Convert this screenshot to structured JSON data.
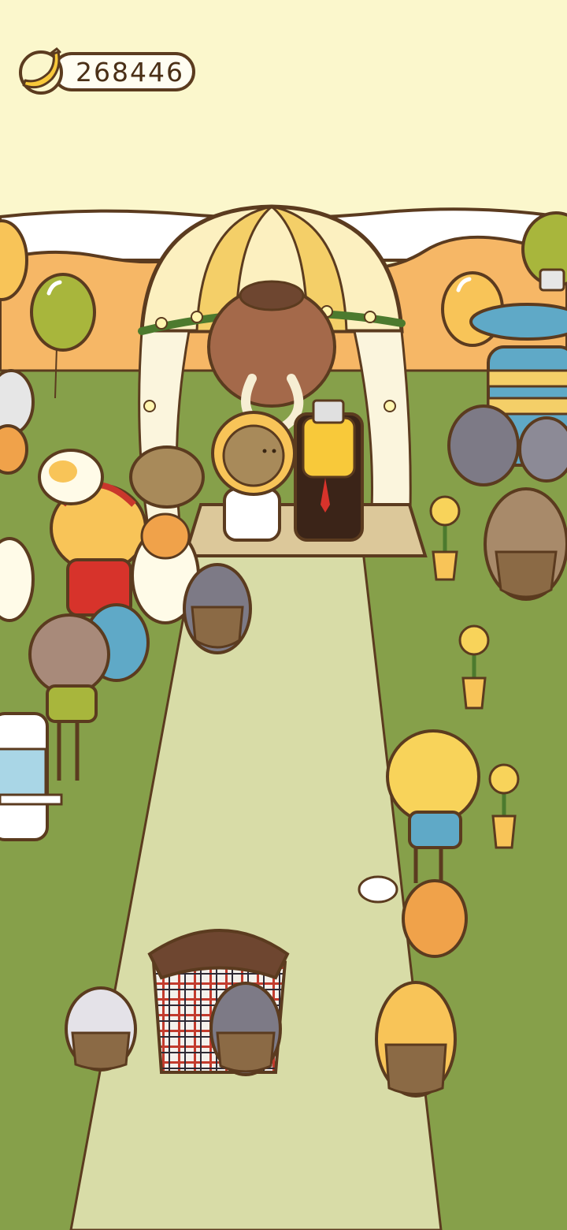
{
  "hud": {
    "banana_count": "268446",
    "currency_icon": "banana-icon"
  },
  "scene": {
    "name": "wedding-ceremony",
    "colors": {
      "sky": "#fbf7cc",
      "grass": "#86a04a",
      "aisle": "#d8dca7",
      "outline": "#5b3b1f",
      "arch_yellow": "#f4cf68",
      "arch_cream": "#fcf0c0"
    }
  }
}
